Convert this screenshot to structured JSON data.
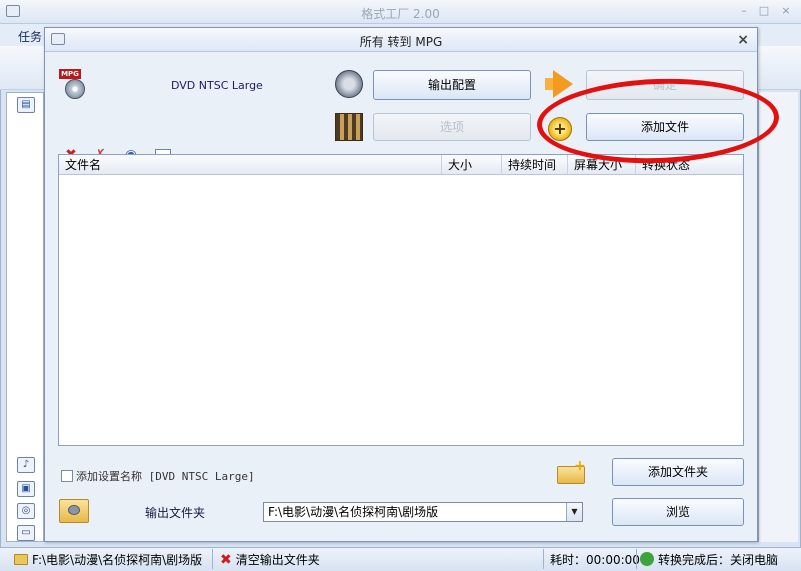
{
  "app": {
    "title": "格式工厂 2.00",
    "menu_first": "任务",
    "win_min": "–",
    "win_max": "□",
    "win_close": "×"
  },
  "dialog": {
    "title": "所有 转到 MPG",
    "close": "×",
    "preset_name": "DVD NTSC Large",
    "mpg_badge": "MPG",
    "output_config_button": "输出配置",
    "ok_button": "确定",
    "options_button": "选项",
    "add_file_button": "添加文件",
    "add_folder_button": "添加文件夹",
    "browse_button": "浏览",
    "add_setting_name_label": "添加设置名称 [DVD NTSC Large]",
    "add_setting_name_checked": false,
    "output_folder_label": "输出文件夹",
    "output_folder_value": "F:\\电影\\动漫\\名侦探柯南\\剧场版",
    "table": {
      "columns": [
        "文件名",
        "大小",
        "持续时间",
        "屏幕大小",
        "转换状态"
      ]
    }
  },
  "statusbar": {
    "path": "F:\\电影\\动漫\\名侦探柯南\\剧场版",
    "clear_output": "清空输出文件夹",
    "elapsed": "耗时：00:00:00",
    "after_convert": "转换完成后：关闭电脑"
  },
  "colors": {
    "annotation_ellipse": "#e31010",
    "accent_blue": "#7a92b8"
  }
}
